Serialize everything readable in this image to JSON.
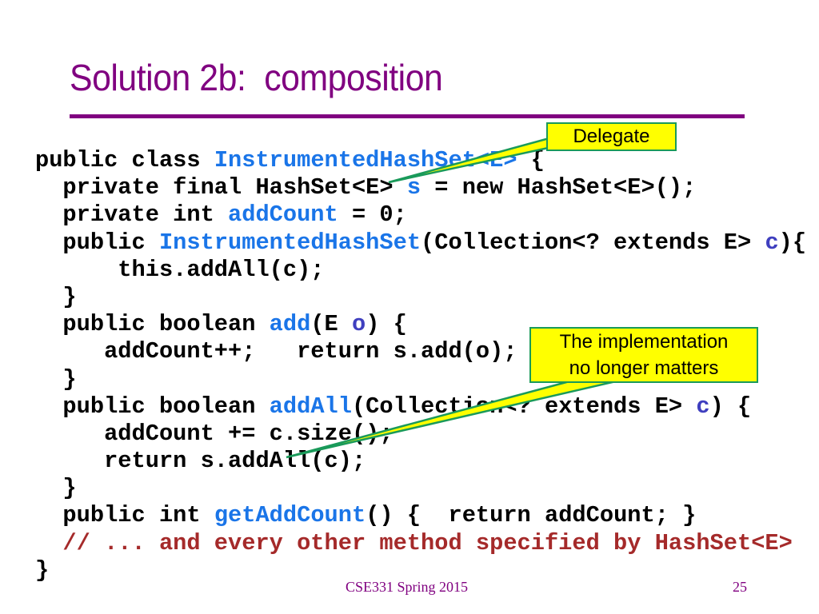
{
  "slide": {
    "title": "Solution 2b:  composition",
    "accent_color": "#800080",
    "code_lines": [
      [
        {
          "t": "public class "
        },
        {
          "t": "InstrumentedHashSet<E>",
          "c": "kw-id"
        },
        {
          "t": " {"
        }
      ],
      [
        {
          "t": "  private final HashSet<E> "
        },
        {
          "t": "s",
          "c": "kw-id"
        },
        {
          "t": " = new HashSet<E>();"
        }
      ],
      [
        {
          "t": "  private int "
        },
        {
          "t": "addCount",
          "c": "kw-id"
        },
        {
          "t": " = 0;"
        }
      ],
      [
        {
          "t": "  public "
        },
        {
          "t": "InstrumentedHashSet",
          "c": "kw-id"
        },
        {
          "t": "(Collection<? extends E> "
        },
        {
          "t": "c",
          "c": "param"
        },
        {
          "t": "){"
        }
      ],
      [
        {
          "t": "      this.addAll(c);"
        }
      ],
      [
        {
          "t": "  }"
        }
      ],
      [
        {
          "t": "  public boolean "
        },
        {
          "t": "add",
          "c": "kw-id"
        },
        {
          "t": "(E "
        },
        {
          "t": "o",
          "c": "param"
        },
        {
          "t": ") {"
        }
      ],
      [
        {
          "t": "     addCount++;   return s.add(o);"
        }
      ],
      [
        {
          "t": "  }"
        }
      ],
      [
        {
          "t": "  public boolean "
        },
        {
          "t": "addAll",
          "c": "kw-id"
        },
        {
          "t": "(Collection<? extends E> "
        },
        {
          "t": "c",
          "c": "param"
        },
        {
          "t": ") {"
        }
      ],
      [
        {
          "t": "     addCount += c.size();"
        }
      ],
      [
        {
          "t": "     return s.addAll(c);"
        }
      ],
      [
        {
          "t": "  }"
        }
      ],
      [
        {
          "t": "  public int "
        },
        {
          "t": "getAddCount",
          "c": "kw-id"
        },
        {
          "t": "() {  return addCount; }"
        }
      ],
      [
        {
          "t": "  // ... and every other method specified by HashSet<E>",
          "c": "comment"
        }
      ],
      [
        {
          "t": "}"
        }
      ]
    ],
    "callouts": {
      "delegate": "Delegate",
      "implementation_line1": "The implementation",
      "implementation_line2": "no longer matters"
    },
    "footer": {
      "course": "CSE331 Spring 2015",
      "page_number": "25"
    }
  }
}
